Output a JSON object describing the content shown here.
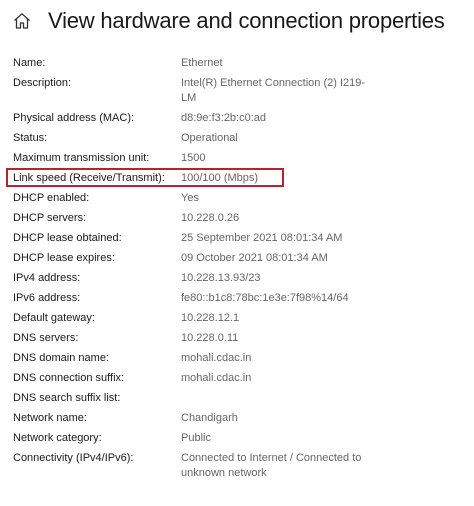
{
  "header": {
    "title": "View hardware and connection properties",
    "icon": "home-icon"
  },
  "properties": [
    {
      "label": "Name:",
      "value": "Ethernet"
    },
    {
      "label": "Description:",
      "value": "Intel(R) Ethernet Connection (2) I219-LM"
    },
    {
      "label": "Physical address (MAC):",
      "value": "d8:9e:f3:2b:c0:ad"
    },
    {
      "label": "Status:",
      "value": "Operational"
    },
    {
      "label": "Maximum transmission unit:",
      "value": "1500"
    },
    {
      "label": "Link speed (Receive/Transmit):",
      "value": "100/100 (Mbps)"
    },
    {
      "label": "DHCP enabled:",
      "value": "Yes"
    },
    {
      "label": "DHCP servers:",
      "value": "10.228.0.26"
    },
    {
      "label": "DHCP lease obtained:",
      "value": "25 September 2021 08:01:34 AM"
    },
    {
      "label": "DHCP lease expires:",
      "value": "09 October 2021 08:01:34 AM"
    },
    {
      "label": "IPv4 address:",
      "value": "10.228.13.93/23"
    },
    {
      "label": "IPv6 address:",
      "value": "fe80::b1c8:78bc:1e3e:7f98%14/64"
    },
    {
      "label": "Default gateway:",
      "value": "10.228.12.1"
    },
    {
      "label": "DNS servers:",
      "value": "10.228.0.11"
    },
    {
      "label": "DNS domain name:",
      "value": "mohali.cdac.in"
    },
    {
      "label": "DNS connection suffix:",
      "value": "mohali.cdac.in"
    },
    {
      "label": "DNS search suffix list:",
      "value": ""
    },
    {
      "label": "Network name:",
      "value": "Chandigarh"
    },
    {
      "label": "Network category:",
      "value": "Public"
    },
    {
      "label": "Connectivity (IPv4/IPv6):",
      "value": "Connected to Internet / Connected to unknown network"
    }
  ],
  "colors": {
    "highlight_border": "#b5242a",
    "value_text": "#666666",
    "label_text": "#1a1a1a"
  }
}
